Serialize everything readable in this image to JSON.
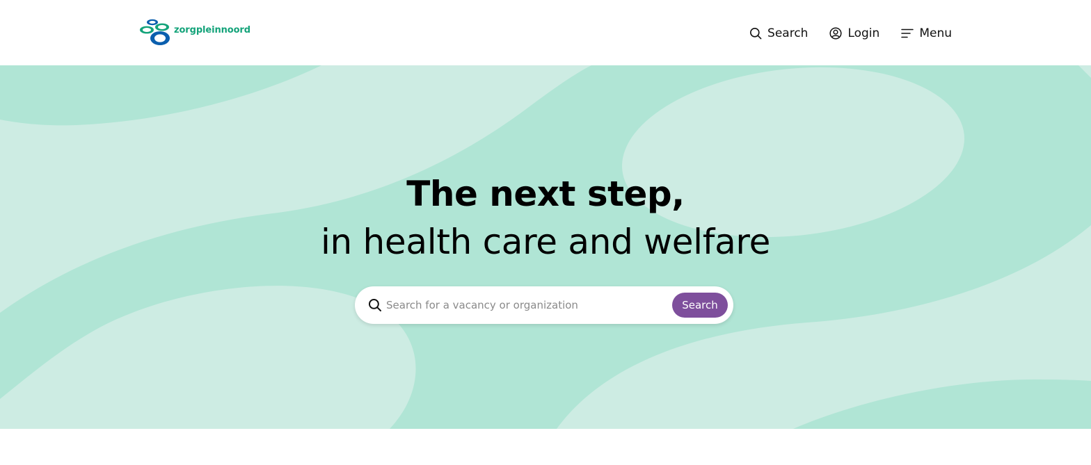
{
  "header": {
    "logo_text": "zorgpleinnoord",
    "nav": {
      "search_label": "Search",
      "login_label": "Login",
      "menu_label": "Menu"
    }
  },
  "hero": {
    "headline": "The next step,",
    "subheadline": "in health care and welfare",
    "search": {
      "placeholder": "Search for a vacancy or organization",
      "value": "",
      "button_label": "Search"
    }
  },
  "icons": {
    "logo": "zorgpleinnoord-logo-icon",
    "nav_search": "search-icon",
    "nav_login": "user-circle-icon",
    "nav_menu": "hamburger-menu-icon",
    "search_bar": "search-icon"
  },
  "colors": {
    "brand_green": "#14a37a",
    "brand_blue": "#0b5fae",
    "hero_light": "#cdece3",
    "hero_mid": "#b0e5d5",
    "accent_purple": "#7e4f9c",
    "text": "#111111"
  }
}
